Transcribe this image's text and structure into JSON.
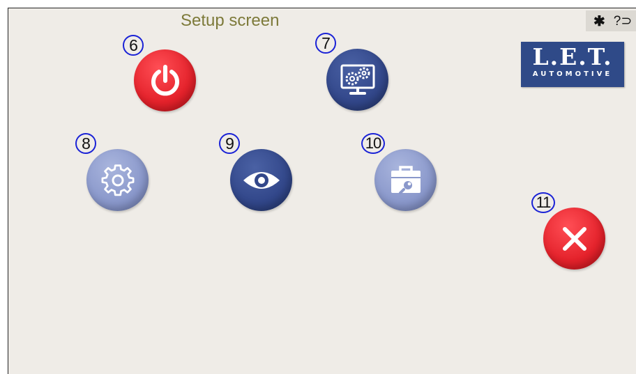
{
  "title": "Setup screen",
  "status": {
    "bluetooth_glyph": "✱",
    "status_text": "?⊃"
  },
  "logo": {
    "main": "L.E.T.",
    "sub": "AUTOMOTIVE"
  },
  "buttons": [
    {
      "id": "power",
      "marker": "6",
      "icon": "power-icon",
      "color": "#e4222b"
    },
    {
      "id": "system-settings",
      "marker": "7",
      "icon": "monitor-gears-icon",
      "color": "#32478a"
    },
    {
      "id": "settings",
      "marker": "8",
      "icon": "gear-icon",
      "color": "#8a98cb"
    },
    {
      "id": "view",
      "marker": "9",
      "icon": "eye-icon",
      "color": "#32478a"
    },
    {
      "id": "toolbox",
      "marker": "10",
      "icon": "toolbox-icon",
      "color": "#8a98cb"
    },
    {
      "id": "close",
      "marker": "11",
      "icon": "close-icon",
      "color": "#e4222b"
    }
  ]
}
